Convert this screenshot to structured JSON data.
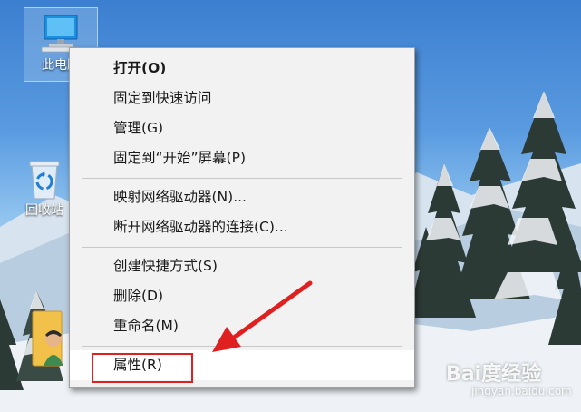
{
  "desktop": {
    "icons": [
      {
        "label": "此电脑",
        "icon": "computer-icon"
      },
      {
        "label": "回收站",
        "icon": "recycle-bin-icon"
      },
      {
        "label": "",
        "icon": "user-folder-icon"
      }
    ]
  },
  "context_menu": {
    "groups": [
      [
        {
          "label": "打开(O)",
          "bold": true
        },
        {
          "label": "固定到快速访问"
        },
        {
          "label": "管理(G)"
        },
        {
          "label": "固定到“开始”屏幕(P)"
        }
      ],
      [
        {
          "label": "映射网络驱动器(N)..."
        },
        {
          "label": "断开网络驱动器的连接(C)..."
        }
      ],
      [
        {
          "label": "创建快捷方式(S)"
        },
        {
          "label": "删除(D)"
        },
        {
          "label": "重命名(M)"
        }
      ],
      [
        {
          "label": "属性(R)",
          "hovered": true
        }
      ]
    ]
  },
  "annotation": {
    "highlight_color": "#e02020",
    "arrow_color": "#e02020"
  },
  "watermark": {
    "brand": "Bai度经验",
    "url": "jingyan.baidu.com"
  }
}
